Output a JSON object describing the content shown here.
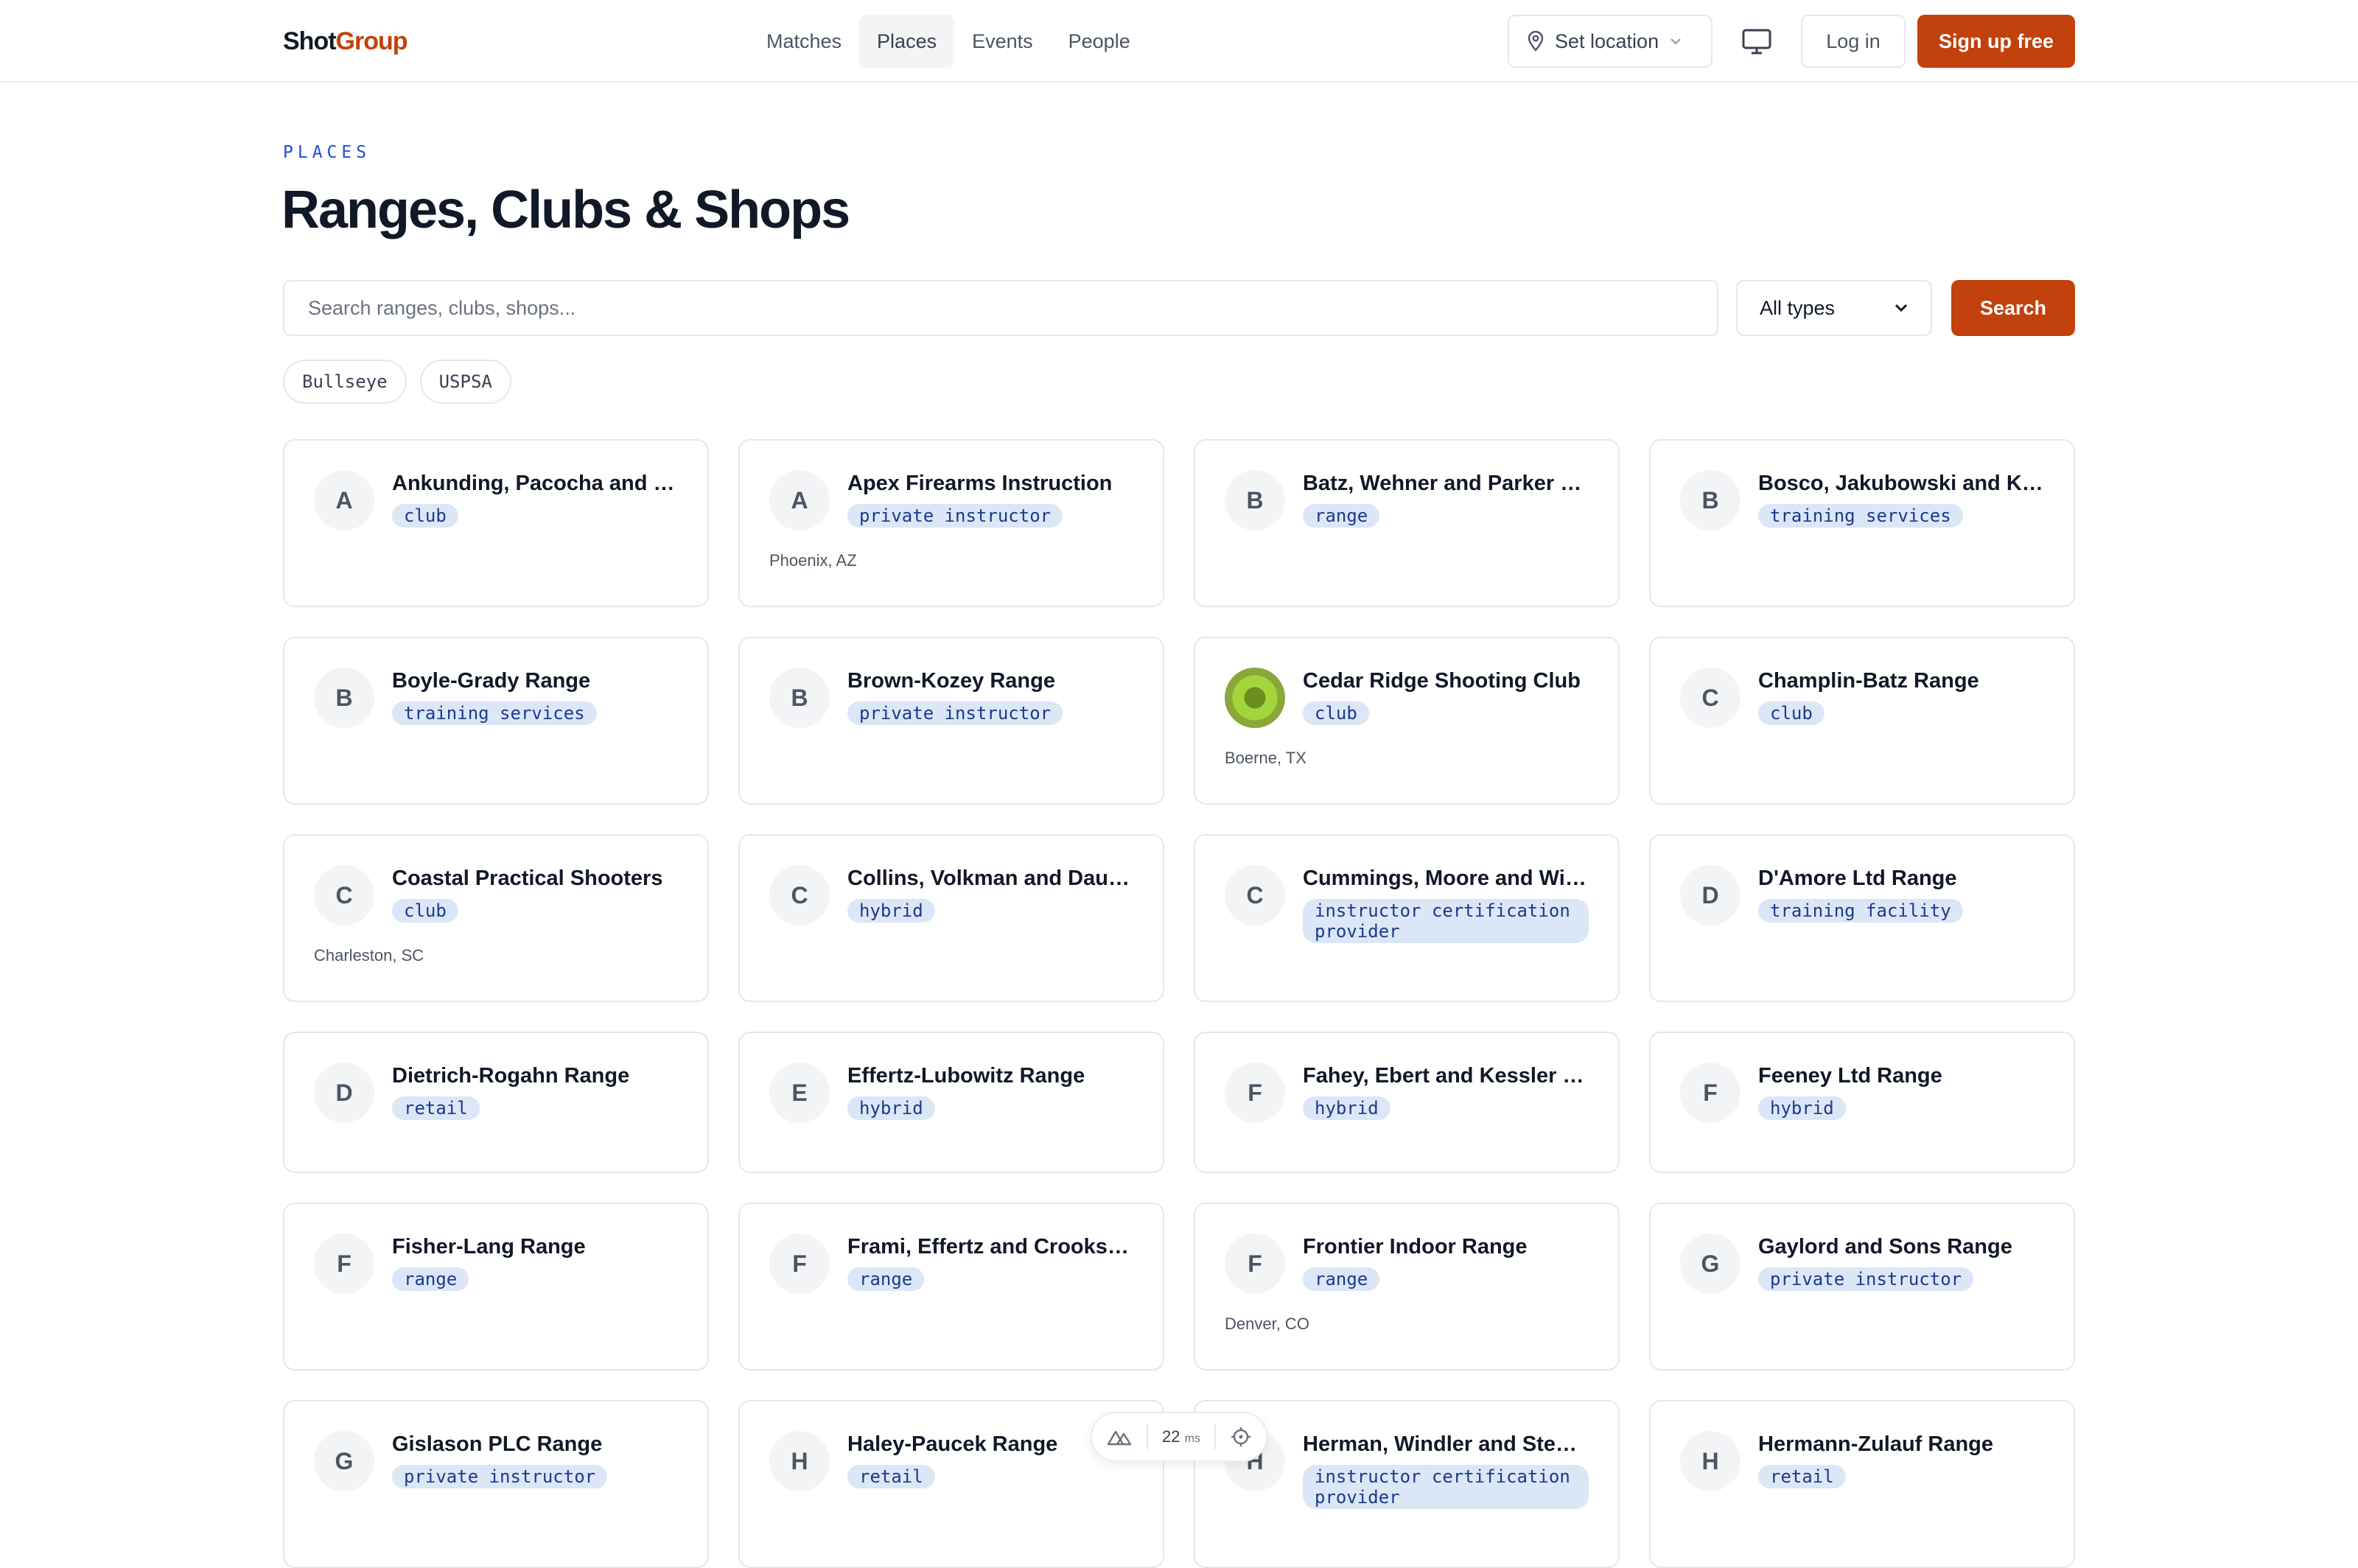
{
  "header": {
    "logo_part1": "Shot",
    "logo_part2": "Group",
    "nav": [
      {
        "label": "Matches",
        "active": false
      },
      {
        "label": "Places",
        "active": true
      },
      {
        "label": "Events",
        "active": false
      },
      {
        "label": "People",
        "active": false
      }
    ],
    "location_label": "Set location",
    "login_label": "Log in",
    "signup_label": "Sign up free"
  },
  "page": {
    "eyebrow": "PLACES",
    "title": "Ranges, Clubs & Shops"
  },
  "search": {
    "placeholder": "Search ranges, clubs, shops...",
    "type_selected": "All types",
    "button_label": "Search",
    "chips": [
      "Bullseye",
      "USPSA"
    ]
  },
  "places": [
    {
      "initial": "A",
      "name": "Ankunding, Pacocha and Bergnaum Range",
      "tag": "club",
      "location": ""
    },
    {
      "initial": "A",
      "name": "Apex Firearms Instruction",
      "tag": "private instructor",
      "location": "Phoenix, AZ"
    },
    {
      "initial": "B",
      "name": "Batz, Wehner and Parker Range",
      "tag": "range",
      "location": ""
    },
    {
      "initial": "B",
      "name": "Bosco, Jakubowski and Klein Range",
      "tag": "training services",
      "location": ""
    },
    {
      "initial": "B",
      "name": "Boyle-Grady Range",
      "tag": "training services",
      "location": ""
    },
    {
      "initial": "B",
      "name": "Brown-Kozey Range",
      "tag": "private instructor",
      "location": ""
    },
    {
      "initial": "",
      "name": "Cedar Ridge Shooting Club",
      "tag": "club",
      "location": "Boerne, TX",
      "has_logo": true
    },
    {
      "initial": "C",
      "name": "Champlin-Batz Range",
      "tag": "club",
      "location": ""
    },
    {
      "initial": "C",
      "name": "Coastal Practical Shooters",
      "tag": "club",
      "location": "Charleston, SC"
    },
    {
      "initial": "C",
      "name": "Collins, Volkman and Daugherty Range",
      "tag": "hybrid",
      "location": ""
    },
    {
      "initial": "C",
      "name": "Cummings, Moore and Wilkinson Range",
      "tag": "instructor certification provider",
      "location": ""
    },
    {
      "initial": "D",
      "name": "D'Amore Ltd Range",
      "tag": "training facility",
      "location": ""
    },
    {
      "initial": "D",
      "name": "Dietrich-Rogahn Range",
      "tag": "retail",
      "location": ""
    },
    {
      "initial": "E",
      "name": "Effertz-Lubowitz Range",
      "tag": "hybrid",
      "location": ""
    },
    {
      "initial": "F",
      "name": "Fahey, Ebert and Kessler Range",
      "tag": "hybrid",
      "location": ""
    },
    {
      "initial": "F",
      "name": "Feeney Ltd Range",
      "tag": "hybrid",
      "location": ""
    },
    {
      "initial": "F",
      "name": "Fisher-Lang Range",
      "tag": "range",
      "location": ""
    },
    {
      "initial": "F",
      "name": "Frami, Effertz and Crooks Range",
      "tag": "range",
      "location": ""
    },
    {
      "initial": "F",
      "name": "Frontier Indoor Range",
      "tag": "range",
      "location": "Denver, CO"
    },
    {
      "initial": "G",
      "name": "Gaylord and Sons Range",
      "tag": "private instructor",
      "location": ""
    },
    {
      "initial": "G",
      "name": "Gislason PLC Range",
      "tag": "private instructor",
      "location": ""
    },
    {
      "initial": "H",
      "name": "Haley-Paucek Range",
      "tag": "retail",
      "location": ""
    },
    {
      "initial": "H",
      "name": "Herman, Windler and Steuber Range",
      "tag": "instructor certification provider",
      "location": ""
    },
    {
      "initial": "H",
      "name": "Hermann-Zulauf Range",
      "tag": "retail",
      "location": ""
    }
  ],
  "perf": {
    "value": "22",
    "unit": "ms"
  },
  "colors": {
    "accent": "#c2410c",
    "tag_bg": "#dbe6f7",
    "tag_text": "#1e3a8a",
    "eyebrow": "#1d4ed8"
  }
}
